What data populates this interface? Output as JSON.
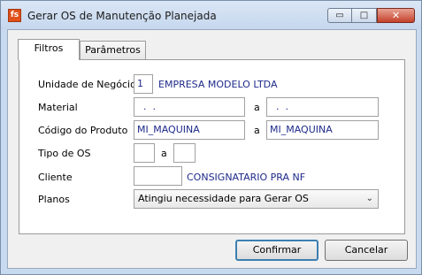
{
  "window": {
    "title": "Gerar OS de Manutenção Planejada",
    "icon": "app-logo-icon",
    "icon_glyph": "fs"
  },
  "controls": {
    "minimize": "▭",
    "maximize": "□",
    "close": "✕"
  },
  "tabs": [
    {
      "label": "Filtros",
      "active": true
    },
    {
      "label": "Parâmetros",
      "active": false
    }
  ],
  "form": {
    "unidade": {
      "label": "Unidade de Negócio",
      "value": "1",
      "description": "EMPRESA MODELO LTDA"
    },
    "material": {
      "label": "Material",
      "from": "  .  .",
      "separator": "a",
      "to": "  .  ."
    },
    "codigo": {
      "label": "Código do Produto",
      "from": "MI_MAQUINA",
      "separator": "a",
      "to": "MI_MAQUINA"
    },
    "tipo_os": {
      "label": "Tipo de OS",
      "from": "",
      "separator": "a",
      "to": ""
    },
    "cliente": {
      "label": "Cliente",
      "value": "",
      "description": "CONSIGNATARIO PRA NF"
    },
    "planos": {
      "label": "Planos",
      "selected": "Atingiu necessidade para Gerar OS"
    }
  },
  "buttons": {
    "confirm": "Confirmar",
    "cancel": "Cancelar"
  },
  "colors": {
    "value_text": "#1e2a8a",
    "accent": "#3c7fb1",
    "close": "#c4402a"
  }
}
